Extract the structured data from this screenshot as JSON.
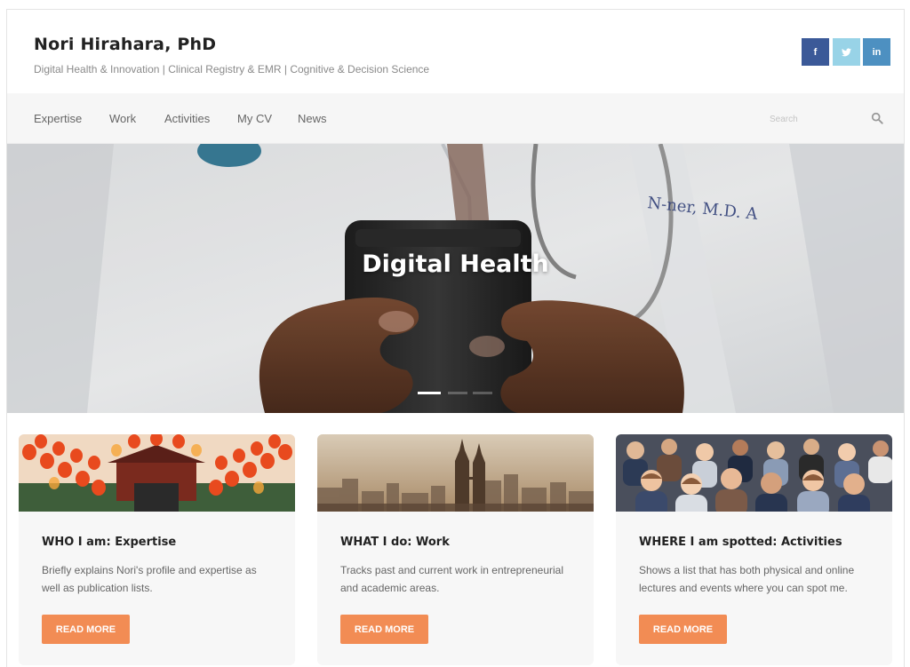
{
  "header": {
    "site_title": "Nori Hirahara, PhD",
    "tagline": "Digital Health & Innovation | Clinical Registry & EMR | Cognitive & Decision Science",
    "social": [
      {
        "label": "f",
        "icon": "facebook-icon",
        "color": "#3b5998"
      },
      {
        "label": "t",
        "icon": "twitter-icon",
        "color": "#98d3e7"
      },
      {
        "label": "in",
        "icon": "linkedin-icon",
        "color": "#4d90c1"
      }
    ]
  },
  "nav": {
    "items": [
      {
        "label": "Expertise"
      },
      {
        "label": "Work"
      },
      {
        "label": "Activities"
      },
      {
        "label": "My CV"
      },
      {
        "label": "News"
      }
    ],
    "search": {
      "placeholder": "Search",
      "icon": "search-icon"
    }
  },
  "hero": {
    "title": "Digital Health",
    "slides_total": 3,
    "active_slide": 1
  },
  "cards": [
    {
      "title": "WHO I am: Expertise",
      "text": "Briefly explains Nori's profile and expertise as well as publication lists.",
      "button": "READ MORE",
      "image": "lanterns-temple-image"
    },
    {
      "title": "WHAT I do: Work",
      "text": "Tracks past and current work in entrepreneurial and academic areas.",
      "button": "READ MORE",
      "image": "city-skyline-image"
    },
    {
      "title": "WHERE I am spotted: Activities",
      "text": "Shows a list that has both physical and online lectures and events where you can spot me.",
      "button": "READ MORE",
      "image": "audience-image"
    }
  ],
  "colors": {
    "accent": "#f28c54",
    "nav_bg": "#f6f6f6",
    "card_bg": "#f7f7f7"
  }
}
